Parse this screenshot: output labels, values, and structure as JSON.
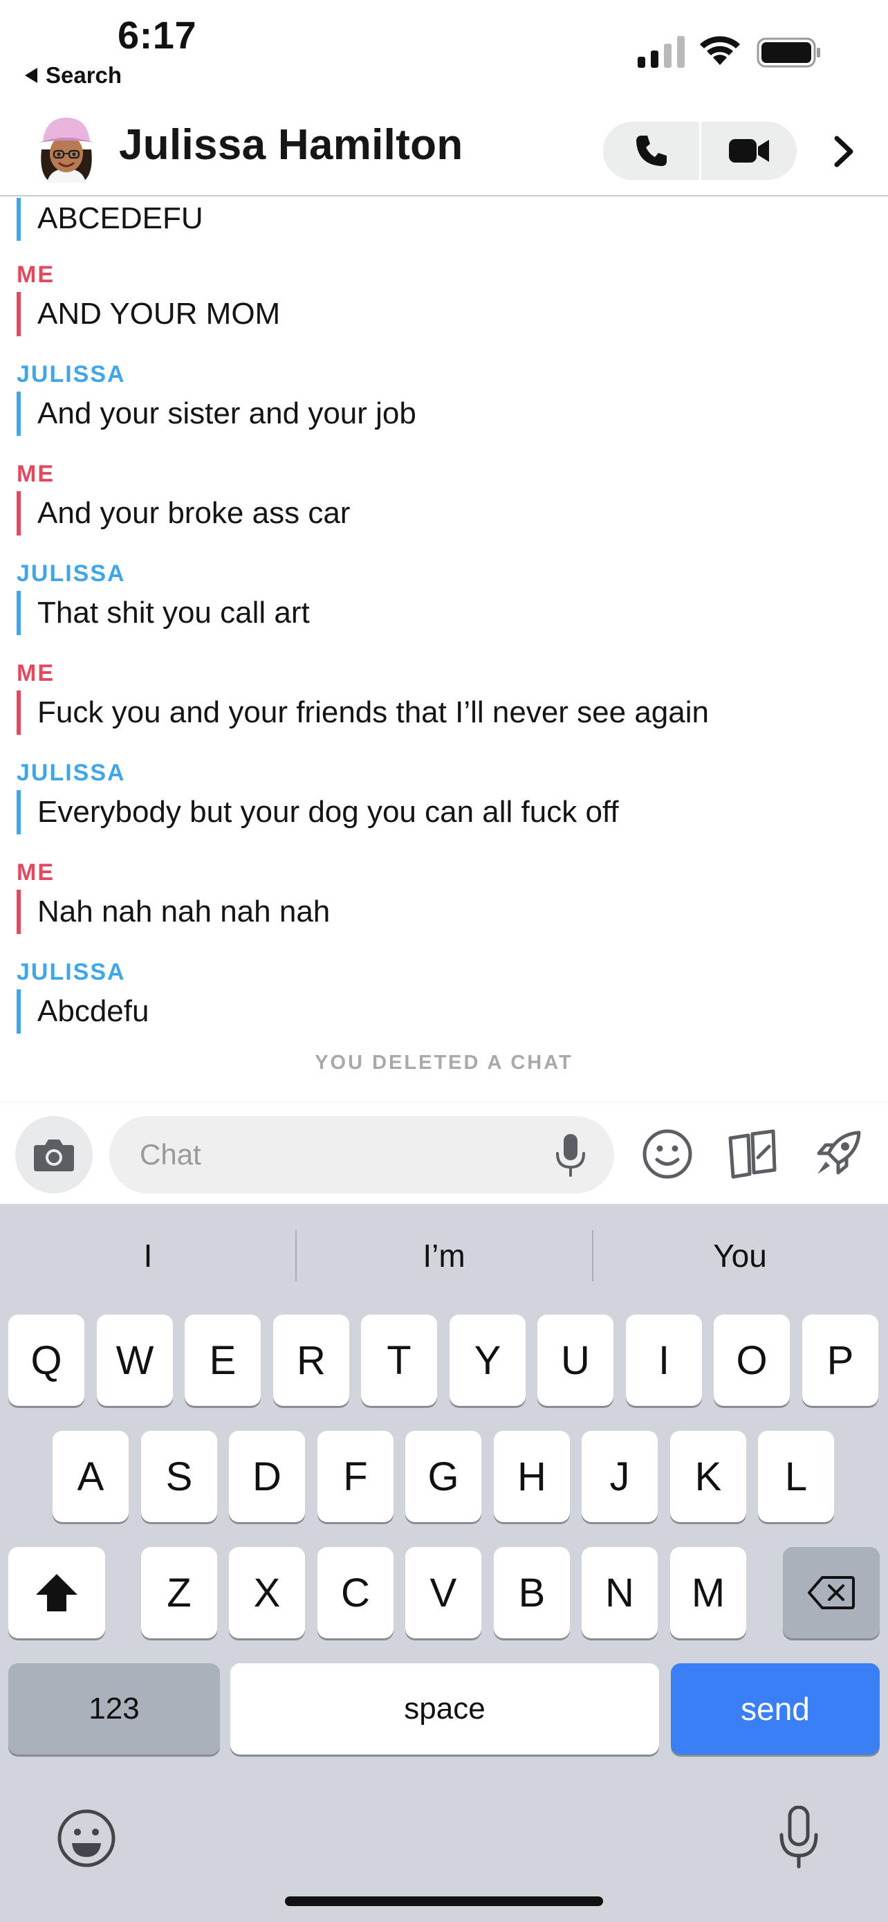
{
  "status_bar": {
    "time": "6:17",
    "back_label": "Search",
    "icons": [
      "cellular-signal-icon",
      "wifi-icon",
      "battery-icon"
    ]
  },
  "header": {
    "contact_name": "Julissa Hamilton",
    "icons": [
      "bitmoji-avatar-icon",
      "phone-icon",
      "video-camera-icon",
      "chevron-right-icon"
    ]
  },
  "colors": {
    "me": "#e04a5f",
    "them": "#41a6e8",
    "send_key": "#3a7ff5",
    "keyboard_bg": "#d1d4da"
  },
  "messages": [
    {
      "sender": "",
      "side": "them",
      "text": "ABCEDEFU"
    },
    {
      "sender": "ME",
      "side": "me",
      "text": "AND YOUR MOM"
    },
    {
      "sender": "JULISSA",
      "side": "them",
      "text": "And your sister and your job"
    },
    {
      "sender": "ME",
      "side": "me",
      "text": "And your broke ass car"
    },
    {
      "sender": "JULISSA",
      "side": "them",
      "text": "That shit you call art"
    },
    {
      "sender": "ME",
      "side": "me",
      "text": "Fuck you and your friends that I’ll never see again"
    },
    {
      "sender": "JULISSA",
      "side": "them",
      "text": "Everybody but your dog you can all fuck off"
    },
    {
      "sender": "ME",
      "side": "me",
      "text": "Nah nah nah nah nah"
    },
    {
      "sender": "JULISSA",
      "side": "them",
      "text": "Abcdefu"
    }
  ],
  "deleted_note": "YOU DELETED A CHAT",
  "input_bar": {
    "placeholder": "Chat",
    "icons": [
      "camera-icon",
      "microphone-icon",
      "emoji-icon",
      "cards-icon",
      "rocket-icon"
    ]
  },
  "keyboard": {
    "suggestions": [
      "I",
      "I’m",
      "You"
    ],
    "row1": [
      "Q",
      "W",
      "E",
      "R",
      "T",
      "Y",
      "U",
      "I",
      "O",
      "P"
    ],
    "row2": [
      "A",
      "S",
      "D",
      "F",
      "G",
      "H",
      "J",
      "K",
      "L"
    ],
    "row3": [
      "Z",
      "X",
      "C",
      "V",
      "B",
      "N",
      "M"
    ],
    "numbers_label": "123",
    "space_label": "space",
    "send_label": "send"
  }
}
